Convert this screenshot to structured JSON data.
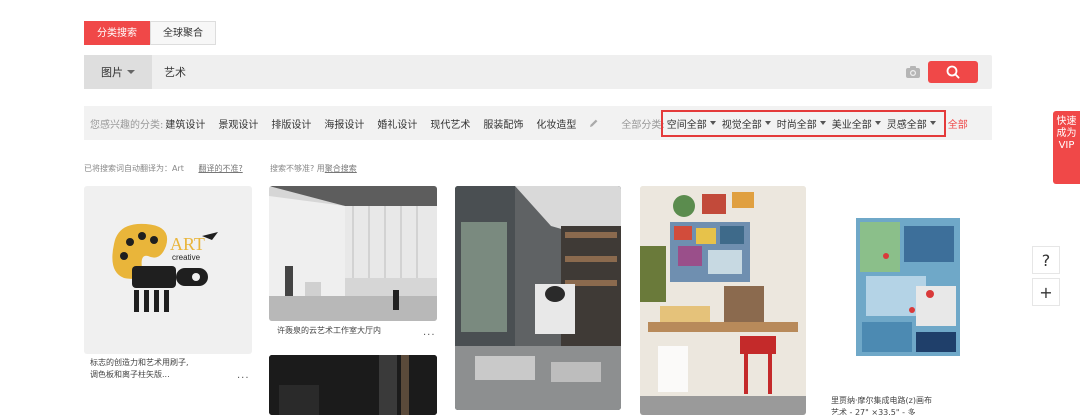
{
  "tabs": [
    {
      "label": "分类搜索"
    },
    {
      "label": "全球聚合"
    }
  ],
  "search": {
    "type_label": "图片",
    "query": "艺术"
  },
  "categories": {
    "label": "您感兴趣的分类:",
    "items": [
      "建筑设计",
      "景观设计",
      "排版设计",
      "海报设计",
      "婚礼设计",
      "现代艺术",
      "服装配饰",
      "化妆造型"
    ],
    "all_label": "全部分类:",
    "filters": [
      "空间全部",
      "视觉全部",
      "时尚全部",
      "美业全部",
      "灵感全部"
    ],
    "all_link": "全部"
  },
  "hints": {
    "translate_text": "已将搜索词自动翻译为：Art",
    "translate_link": "翻译的不准?",
    "accuracy_text": "搜索不够准? 用",
    "accuracy_link": "聚合搜索"
  },
  "results": [
    {
      "caption_line1": "标志的创造力和艺术用刷子,",
      "caption_line2": "调色板和离子柱矢版...",
      "more": "...",
      "logo_text": "ART",
      "logo_sub": "creative"
    },
    {
      "caption_line1": "许轰泉的云艺术工作室大厅内",
      "more": "..."
    },
    {},
    {},
    {
      "caption_line1": "里贾纳·摩尔集成电路(z)画布",
      "caption_line2": "艺术 - 27\" ×33.5\" - 多"
    }
  ],
  "sidebar": {
    "vip_label": "快速成为VIP",
    "help_label": "?",
    "add_label": "+"
  },
  "colors": {
    "accent": "#f04848",
    "highlight_border": "#e43a3a"
  }
}
